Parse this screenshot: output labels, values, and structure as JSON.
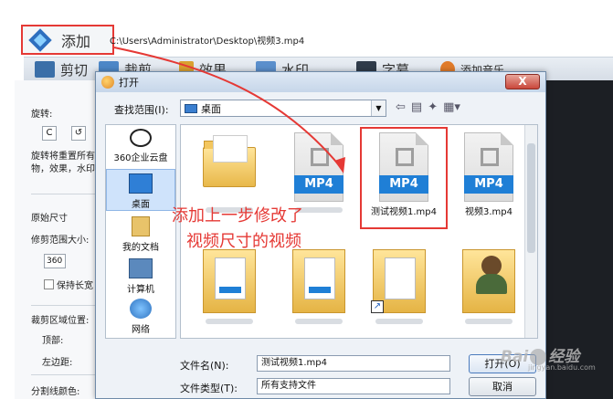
{
  "app": {
    "add_label": "添加",
    "file_path": "C:\\Users\\Administrator\\Desktop\\视频3.mp4"
  },
  "toolbar": {
    "items": [
      "剪切",
      "裁剪",
      "效果",
      "水印",
      "字幕",
      "添加音乐"
    ]
  },
  "left_panel": {
    "rotate_label": "旋转:",
    "rotate_cw": "C",
    "rotate_ccw": "↺",
    "note_line1": "旋转将重置所有",
    "note_line2": "物，效果，水印",
    "orig_size": "原始尺寸",
    "crop_range": "修剪范围大小:",
    "width_value": "360",
    "keep_ratio": "保持长宽",
    "crop_pos": "裁剪区域位置:",
    "top_label": "顶部:",
    "left_label": "左边距:",
    "line_color": "分割线颜色:"
  },
  "dialog": {
    "title": "打开",
    "close_label": "X",
    "look_in_label": "查找范围(I):",
    "look_in_value": "桌面",
    "places": [
      {
        "label": "360企业云盘"
      },
      {
        "label": "桌面"
      },
      {
        "label": "我的文档"
      },
      {
        "label": "计算机"
      },
      {
        "label": "网络"
      }
    ],
    "files": [
      {
        "name": "测试视频1.mp4",
        "badge": "MP4"
      },
      {
        "name": "视频3.mp4",
        "badge": "MP4"
      },
      {
        "badge": "MP4"
      }
    ],
    "filename_label": "文件名(N):",
    "filename_value": "测试视频1.mp4",
    "filetype_label": "文件类型(T):",
    "filetype_value": "所有支持文件",
    "open_label": "打开(O)",
    "cancel_label": "取消"
  },
  "annotation": {
    "line1": "添加上一步修改了",
    "line2": "视频尺寸的视频",
    "color": "#e53935"
  },
  "watermark": {
    "text_left": "Bai",
    "text_right": "经验",
    "sub": "jingyan.baidu.com"
  }
}
